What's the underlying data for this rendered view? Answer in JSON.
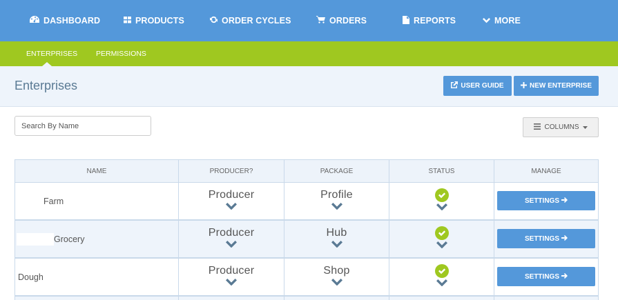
{
  "topnav": {
    "items": [
      {
        "label": "DASHBOARD",
        "icon": "dashboard-icon"
      },
      {
        "label": "PRODUCTS",
        "icon": "grid-icon"
      },
      {
        "label": "ORDER CYCLES",
        "icon": "refresh-icon"
      },
      {
        "label": "ORDERS",
        "icon": "cart-icon"
      },
      {
        "label": "REPORTS",
        "icon": "document-icon"
      },
      {
        "label": "MORE",
        "icon": "chevron-down-icon"
      }
    ]
  },
  "subnav": {
    "items": [
      {
        "label": "ENTERPRISES",
        "active": true
      },
      {
        "label": "PERMISSIONS",
        "active": false
      }
    ]
  },
  "header": {
    "title": "Enterprises",
    "user_guide_label": "USER GUIDE",
    "new_enterprise_label": "NEW ENTERPRISE"
  },
  "search": {
    "placeholder": "Search By Name",
    "value": ""
  },
  "columns_button": {
    "label": "COLUMNS"
  },
  "table": {
    "headers": [
      "NAME",
      "PRODUCER?",
      "PACKAGE",
      "STATUS",
      "MANAGE"
    ],
    "rows": [
      {
        "name": "Farm",
        "producer": "Producer",
        "package": "Profile",
        "status": "ok",
        "manage": "SETTINGS"
      },
      {
        "name": "Grocery",
        "producer": "Producer",
        "package": "Hub",
        "status": "ok",
        "manage": "SETTINGS"
      },
      {
        "name": "Dough",
        "producer": "Producer",
        "package": "Shop",
        "status": "ok",
        "manage": "SETTINGS"
      }
    ]
  },
  "colors": {
    "primary": "#5498da",
    "subnav": "#9fc820",
    "status_ok": "#9fc820",
    "header_bg": "#eef4fb"
  }
}
